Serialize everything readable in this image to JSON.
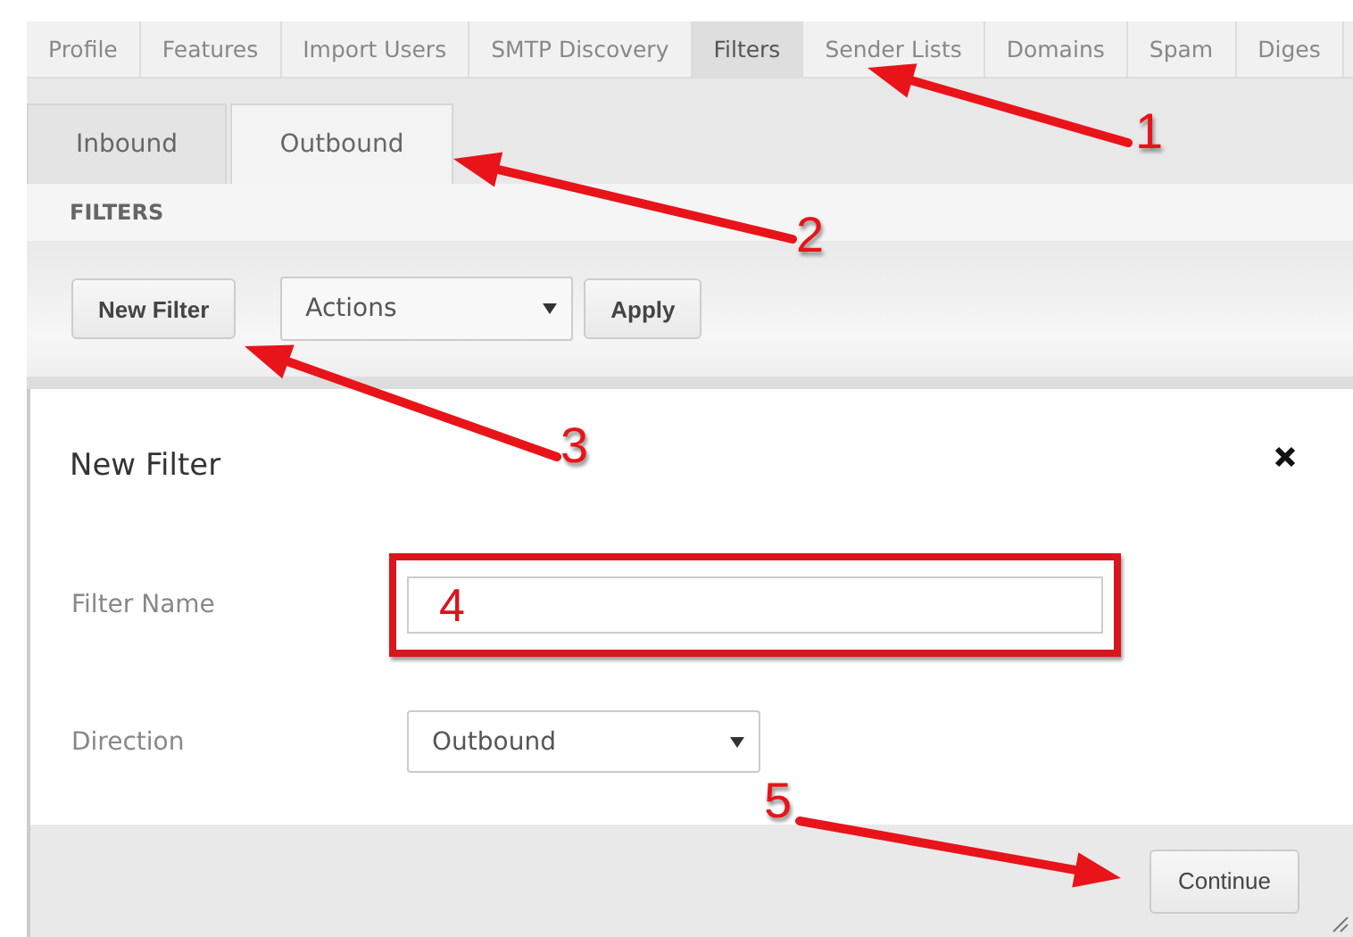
{
  "top_tabs": [
    {
      "label": "Profile",
      "selected": false
    },
    {
      "label": "Features",
      "selected": false
    },
    {
      "label": "Import Users",
      "selected": false
    },
    {
      "label": "SMTP Discovery",
      "selected": false
    },
    {
      "label": "Filters",
      "selected": true
    },
    {
      "label": "Sender Lists",
      "selected": false
    },
    {
      "label": "Domains",
      "selected": false
    },
    {
      "label": "Spam",
      "selected": false
    },
    {
      "label": "Diges",
      "selected": false
    }
  ],
  "sub_tabs": [
    {
      "label": "Inbound",
      "selected": false
    },
    {
      "label": "Outbound",
      "selected": true
    }
  ],
  "section_title": "FILTERS",
  "toolbar": {
    "new_button": "New Filter",
    "actions_select": "Actions",
    "apply_button": "Apply"
  },
  "dialog": {
    "title": "New Filter",
    "fields": [
      {
        "kind": "text",
        "label": "Filter Name",
        "callout": "4"
      },
      {
        "kind": "select",
        "label": "Direction",
        "value": "Outbound"
      }
    ],
    "continue_button": "Continue"
  },
  "annotations": [
    {
      "number": "1"
    },
    {
      "number": "2"
    },
    {
      "number": "3"
    },
    {
      "number": "5"
    }
  ]
}
